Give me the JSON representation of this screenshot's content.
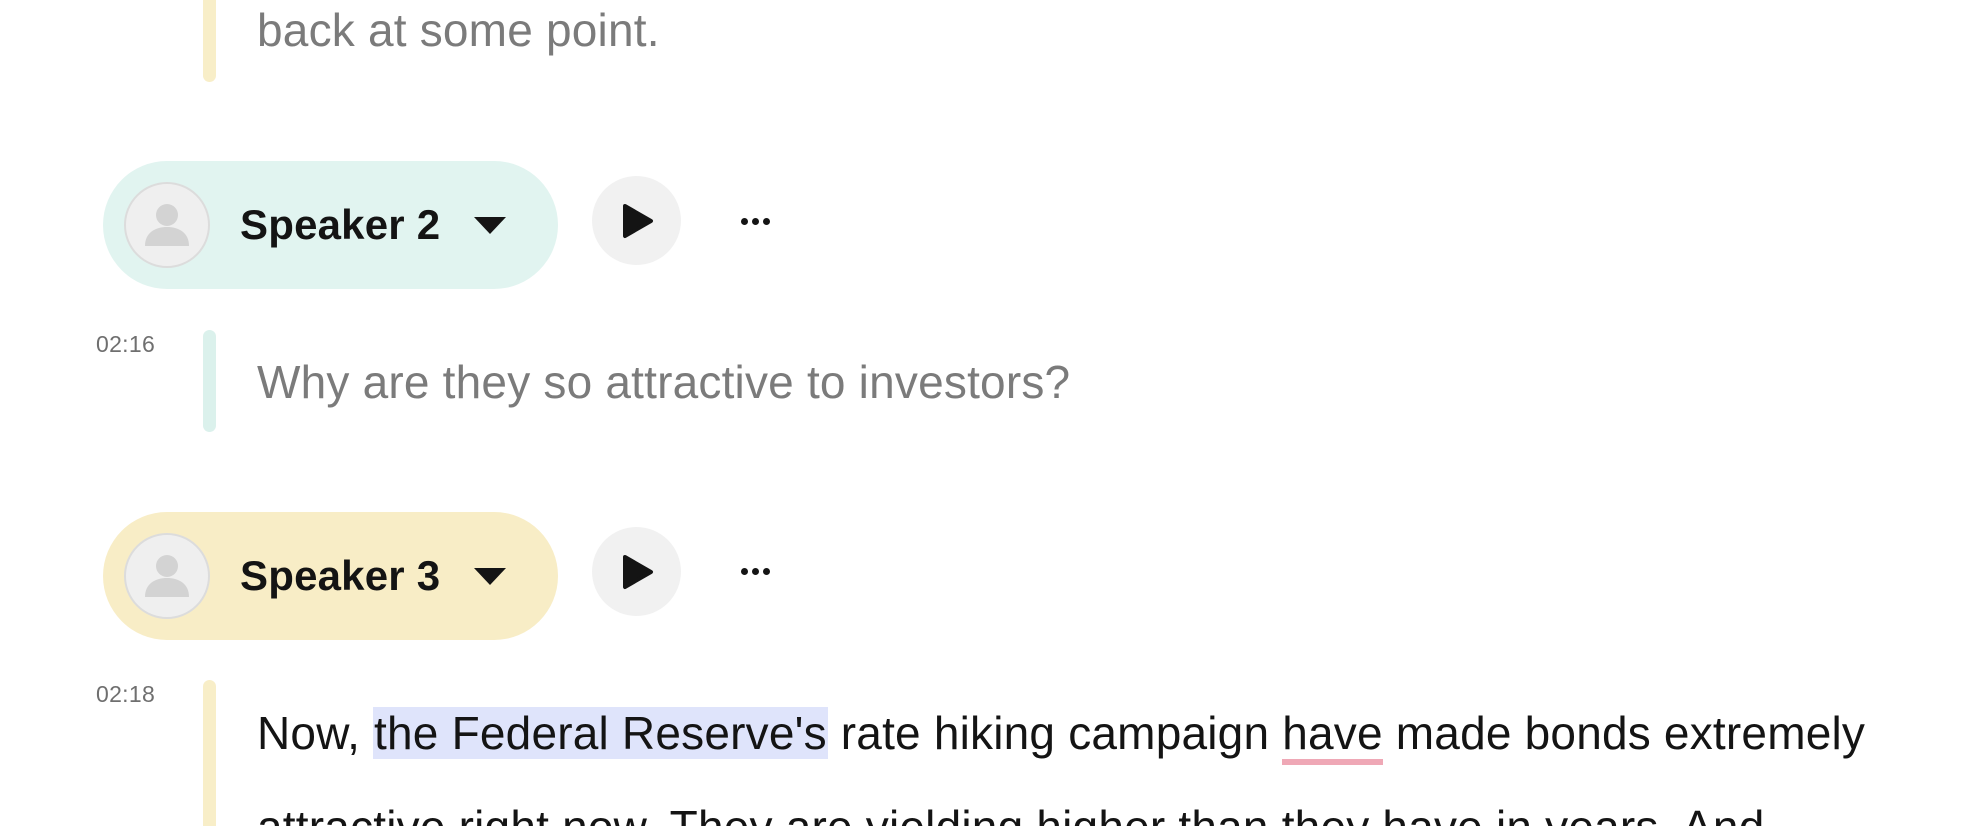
{
  "segments": [
    {
      "text": "back at some point.",
      "accent_color": "#f8eec8"
    },
    {
      "speaker": "Speaker 2",
      "pill_color": "#e1f4f0",
      "timestamp": "02:16",
      "text": "Why are they so attractive to investors?",
      "accent_color": "#dbf1ec"
    },
    {
      "speaker": "Speaker 3",
      "pill_color": "#f8edc6",
      "timestamp": "02:18",
      "text_parts": {
        "before": "Now, ",
        "highlight": "the Federal Reserve's",
        "middle": " rate hiking campaign ",
        "flagged": "have",
        "after": " made bonds extremely"
      },
      "next_line": "attractive right now. They are yielding higher than they have in years. And",
      "accent_color": "#f8eec8",
      "highlight_color": "#dfe4fb",
      "flag_color": "#efa8b6"
    }
  ],
  "icons": {
    "avatar": "user-placeholder-icon",
    "play": "play-icon",
    "more": "more-horizontal-icon",
    "dropdown": "caret-down-icon"
  }
}
